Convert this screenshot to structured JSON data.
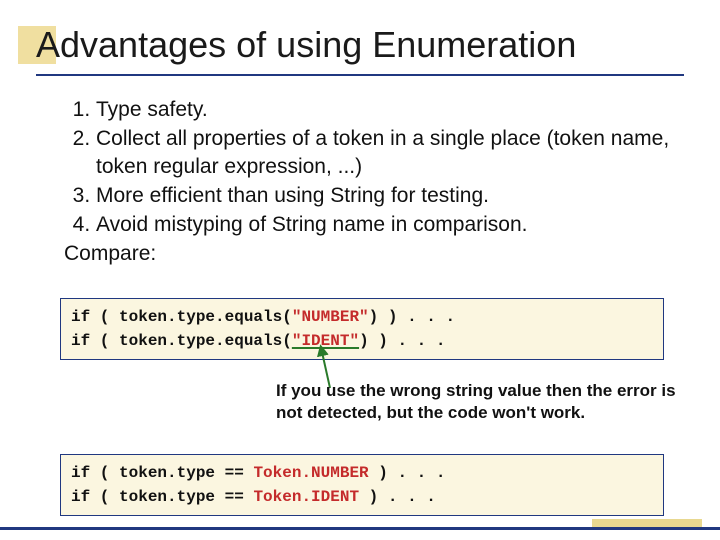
{
  "title": "Advantages of using Enumeration",
  "list": {
    "item1": "Type safety.",
    "item2": "Collect all properties of a token in a single place (token name, token regular expression, ...)",
    "item3": "More efficient than using String for testing.",
    "item4": "Avoid mistyping of String name in comparison."
  },
  "compare_label": "Compare:",
  "code1": {
    "pre_a": "if ( token.type.equals(",
    "str_a": "\"NUMBER\"",
    "post_a": ") ) . . .",
    "pre_b": "if ( token.type.equals(",
    "str_b": "\"IDENT\"",
    "post_b": ") ) . . ."
  },
  "note": "If you use the wrong string value then the error is not detected, but the code won't work.",
  "code2": {
    "pre_a": "if ( token.type == ",
    "cls_a": "Token.NUMBER",
    "post_a": " ) . . .",
    "pre_b": "if ( token.type == ",
    "cls_b": "Token.IDENT",
    "post_b": "  ) . . ."
  }
}
